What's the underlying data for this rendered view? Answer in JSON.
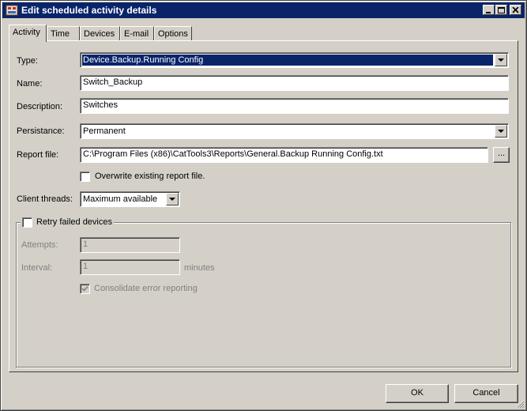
{
  "window": {
    "title": "Edit scheduled activity details"
  },
  "tabs": [
    {
      "label": "Activity",
      "active": true
    },
    {
      "label": "Time"
    },
    {
      "label": "Devices"
    },
    {
      "label": "E-mail"
    },
    {
      "label": "Options"
    }
  ],
  "form": {
    "type_label": "Type:",
    "type_value": "Device.Backup.Running Config",
    "name_label": "Name:",
    "name_value": "Switch_Backup",
    "description_label": "Description:",
    "description_value": "Switches",
    "persistance_label": "Persistance:",
    "persistance_value": "Permanent",
    "report_label": "Report file:",
    "report_value": "C:\\Program Files (x86)\\CatTools3\\Reports\\General.Backup Running Config.txt",
    "browse_label": "...",
    "overwrite_label": "Overwrite existing report file.",
    "threads_label": "Client threads:",
    "threads_value": "Maximum available"
  },
  "retry": {
    "checkbox_label": "Retry failed devices",
    "attempts_label": "Attempts:",
    "attempts_value": "1",
    "interval_label": "Interval:",
    "interval_value": "1",
    "interval_unit": "minutes",
    "consolidate_label": "Consolidate error reporting"
  },
  "buttons": {
    "ok": "OK",
    "cancel": "Cancel"
  }
}
